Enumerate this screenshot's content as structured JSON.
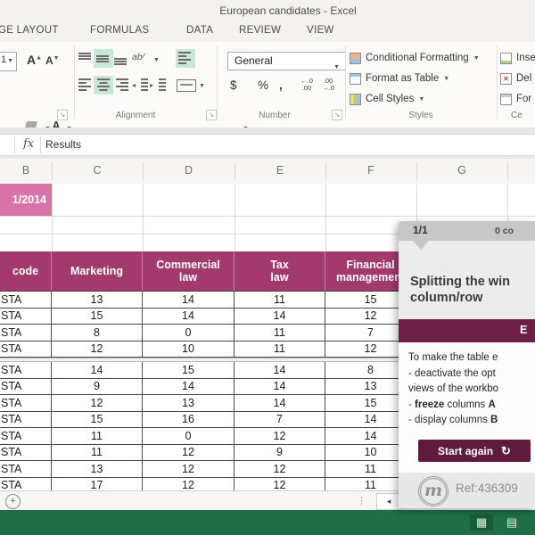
{
  "window": {
    "title": "European candidates - Excel"
  },
  "ribbon": {
    "tabs": [
      {
        "label": "AGE LAYOUT"
      },
      {
        "label": "FORMULAS"
      },
      {
        "label": "DATA"
      },
      {
        "label": "REVIEW"
      },
      {
        "label": "VIEW"
      }
    ],
    "font_group": {
      "font_size_fragment": "1"
    },
    "alignment_group": {
      "label": "Alignment",
      "orientation_text": "ab"
    },
    "number_group": {
      "label": "Number",
      "format": "General",
      "currency": "$",
      "percent": "%",
      "comma": ",",
      "increase_decimal_lines": [
        "←.0",
        ".00"
      ],
      "decrease_decimal_lines": [
        ".00",
        "→.0"
      ]
    },
    "styles_group": {
      "label": "Styles",
      "items": [
        {
          "label": "Conditional Formatting"
        },
        {
          "label": "Format as Table"
        },
        {
          "label": "Cell Styles"
        }
      ]
    },
    "cells_group": {
      "label": "Ce",
      "items": [
        {
          "label": "Inse"
        },
        {
          "label": "Del"
        },
        {
          "label": "For"
        }
      ]
    }
  },
  "formula_bar": {
    "fx": "fx",
    "value": "Results"
  },
  "sheet": {
    "column_letters": [
      "B",
      "C",
      "D",
      "E",
      "F",
      "G"
    ],
    "date_cell": "1/2014",
    "table": {
      "headers": [
        [
          "code"
        ],
        [
          "Marketing"
        ],
        [
          "Commercial",
          "law"
        ],
        [
          "Tax",
          "law"
        ],
        [
          "Financial",
          "management"
        ]
      ],
      "rows": [
        [
          "STA",
          "13",
          "14",
          "11",
          "15"
        ],
        [
          "STA",
          "15",
          "14",
          "14",
          "12"
        ],
        [
          "STA",
          "8",
          "0",
          "11",
          "7"
        ],
        [
          "STA",
          "12",
          "10",
          "11",
          "12"
        ],
        [
          "STA",
          "14",
          "15",
          "14",
          "8"
        ],
        [
          "STA",
          "9",
          "14",
          "14",
          "13"
        ],
        [
          "STA",
          "12",
          "13",
          "14",
          "15"
        ],
        [
          "STA",
          "15",
          "16",
          "7",
          "14"
        ],
        [
          "STA",
          "11",
          "0",
          "12",
          "14"
        ],
        [
          "STA",
          "11",
          "12",
          "9",
          "10"
        ],
        [
          "STA",
          "13",
          "12",
          "12",
          "11"
        ],
        [
          "STA",
          "17",
          "12",
          "12",
          "11"
        ]
      ]
    },
    "new_sheet_button": "+",
    "scroll_left_icon": "◂",
    "tab_dots_icon": "⋮"
  },
  "panel": {
    "pager": "1/1",
    "progress": "0 co",
    "title_lines": [
      "Splitting the win",
      "column/row"
    ],
    "section_bar_label": "E",
    "body_lines": [
      [
        {
          "t": "To make the table e"
        }
      ],
      [
        {
          "t": "- deactivate the opt"
        }
      ],
      [
        {
          "t": "views of the workbo"
        }
      ],
      [
        {
          "t": "- "
        },
        {
          "t": "freeze",
          "b": true
        },
        {
          "t": " columns "
        },
        {
          "t": "A",
          "b": true
        }
      ],
      [
        {
          "t": "- display columns "
        },
        {
          "t": "B",
          "b": true
        }
      ]
    ],
    "start_button": "Start again",
    "refresh_icon": "↻",
    "logo_letter": "m",
    "ref": "Ref:436309"
  },
  "status_bar": {
    "view_icons": [
      {
        "name": "normal-view-icon",
        "glyph": "▦"
      },
      {
        "name": "page-layout-view-icon",
        "glyph": "▤"
      }
    ]
  },
  "colors": {
    "table_header": "#a23a6e",
    "date_cell": "#d873a9",
    "panel_accent": "#6d1f47",
    "button_dark": "#5f1a3e",
    "excel_green": "#1e7044"
  }
}
